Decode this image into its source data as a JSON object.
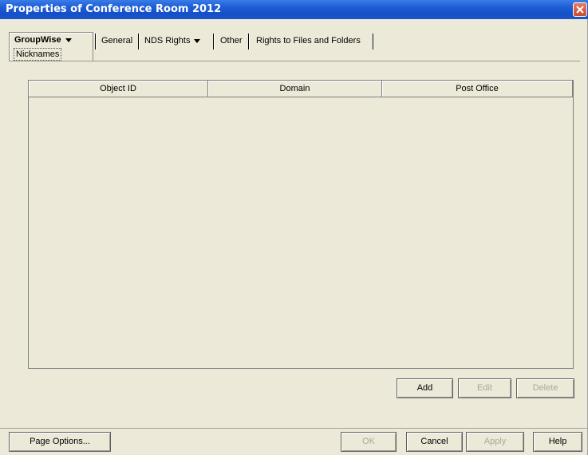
{
  "window": {
    "title": "Properties of Conference Room 2012"
  },
  "tabs": {
    "active": {
      "label": "GroupWise",
      "sub_label": "Nicknames"
    },
    "items": [
      {
        "label": "General"
      },
      {
        "label": "NDS Rights"
      },
      {
        "label": "Other"
      },
      {
        "label": "Rights to Files and Folders"
      }
    ]
  },
  "table": {
    "columns": [
      "Object ID",
      "Domain",
      "Post Office"
    ],
    "rows": []
  },
  "table_buttons": {
    "add": "Add",
    "edit": "Edit",
    "delete": "Delete"
  },
  "footer": {
    "page_options": "Page Options...",
    "ok": "OK",
    "cancel": "Cancel",
    "apply": "Apply",
    "help": "Help"
  },
  "icons": {
    "close": "close-icon",
    "dropdown": "chevron-down-icon"
  }
}
